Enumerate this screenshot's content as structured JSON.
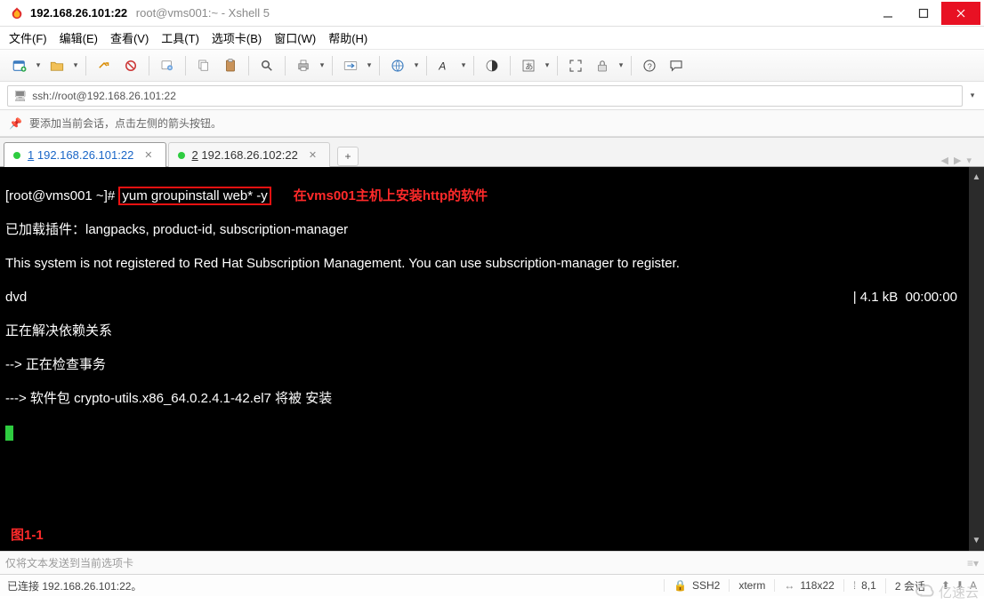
{
  "title": {
    "host": "192.168.26.101:22",
    "session": "root@vms001:~",
    "app": "Xshell 5"
  },
  "menu": {
    "file": "文件(F)",
    "edit": "编辑(E)",
    "view": "查看(V)",
    "tools": "工具(T)",
    "tabs": "选项卡(B)",
    "window": "窗口(W)",
    "help": "帮助(H)"
  },
  "address": {
    "url": "ssh://root@192.168.26.101:22"
  },
  "hint": {
    "text": "要添加当前会话，点击左侧的箭头按钮。"
  },
  "tabs": {
    "items": [
      {
        "index": "1",
        "label": "192.168.26.101:22",
        "active": true
      },
      {
        "index": "2",
        "label": "192.168.26.102:22",
        "active": false
      }
    ],
    "add": "+"
  },
  "terminal": {
    "prompt": "[root@vms001 ~]#",
    "command": "yum groupinstall web* -y",
    "annotation": "在vms001主机上安装http的软件",
    "lines": [
      "已加载插件：langpacks, product-id, subscription-manager",
      "This system is not registered to Red Hat Subscription Management. You can use subscription-manager to register.",
      "dvd",
      "正在解决依赖关系",
      "--> 正在检查事务",
      "---> 软件包 crypto-utils.x86_64.0.2.4.1-42.el7 将被 安装"
    ],
    "dvd_right": "| 4.1 kB  00:00:00",
    "figure_label": "图1-1"
  },
  "send_hint": "仅将文本发送到当前选项卡",
  "status": {
    "left": "已连接 192.168.26.101:22。",
    "ssh": "SSH2",
    "term": "xterm",
    "size": "118x22",
    "cursor": "8,1",
    "sessions": "2 会话"
  },
  "watermark": "亿速云"
}
